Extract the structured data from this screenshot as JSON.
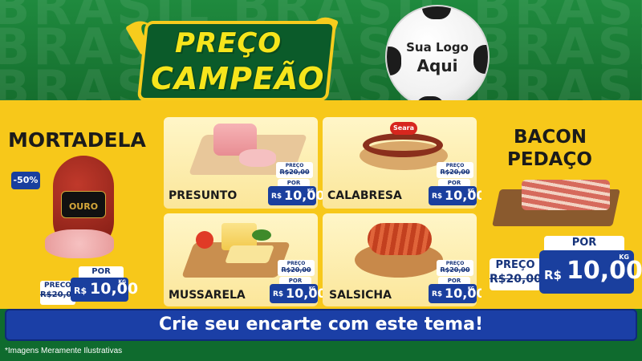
{
  "header": {
    "background_word": "BRASIL BRASIL BRASIL",
    "title_line1": "PREÇO",
    "title_line2": "CAMPEÃO",
    "logo_line1": "Sua Logo",
    "logo_line2": "Aqui"
  },
  "colors": {
    "green": "#146b2c",
    "yellow": "#f7c81a",
    "blue": "#1b3fa6",
    "title_yellow": "#f6e51c"
  },
  "products": {
    "mortadela": {
      "name": "MORTADELA",
      "discount": "-50%",
      "brand": "OURO",
      "price_label": "PRECO",
      "old_price": "R$20,00",
      "por": "POR",
      "currency": "R$",
      "price": "10,00",
      "unit": "KG"
    },
    "presunto": {
      "name": "PRESUNTO",
      "price_label": "PREÇO",
      "old_price": "R$20,00",
      "por": "POR",
      "currency": "R$",
      "price": "10,00",
      "unit": "KG"
    },
    "calabresa": {
      "name": "CALABRESA",
      "brand": "Seara",
      "price_label": "PREÇO",
      "old_price": "R$20,00",
      "por": "POR",
      "currency": "R$",
      "price": "10,00",
      "unit": "KG"
    },
    "mussarela": {
      "name": "MUSSARELA",
      "price_label": "PREÇO",
      "old_price": "R$20,00",
      "por": "POR",
      "currency": "R$",
      "price": "10,00",
      "unit": "KG"
    },
    "salsicha": {
      "name": "SALSICHA",
      "price_label": "PREÇO",
      "old_price": "R$20,00",
      "por": "POR",
      "currency": "R$",
      "price": "10,00",
      "unit": "KG"
    },
    "bacon": {
      "name_line1": "BACON",
      "name_line2": "PEDAÇO",
      "price_label": "PREÇO",
      "old_price": "R$20,00",
      "por": "POR",
      "currency": "R$",
      "price": "10,00",
      "unit": "KG"
    }
  },
  "cta": "Crie seu encarte com este tema!",
  "disclaimer": "*Imagens Meramente Ilustrativas"
}
